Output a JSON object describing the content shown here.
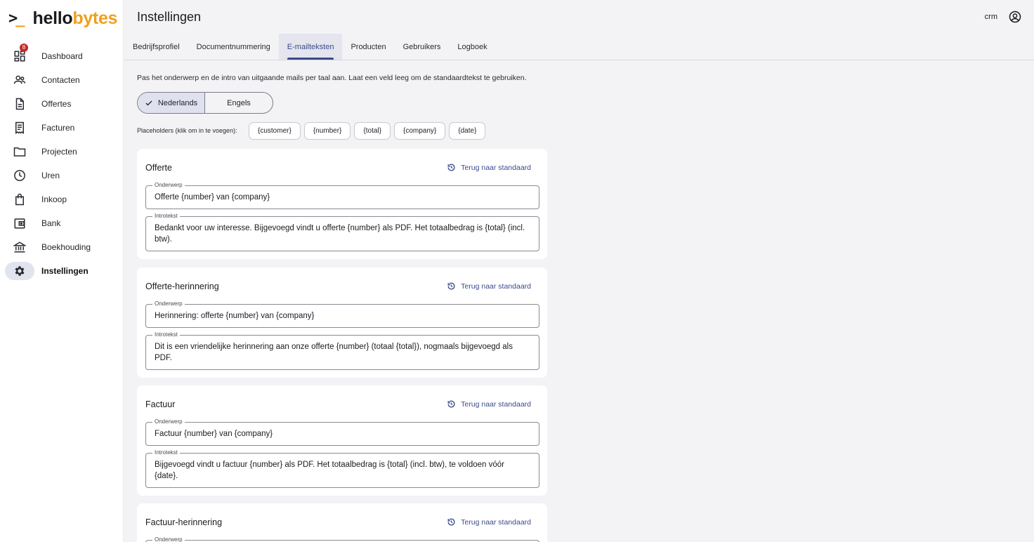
{
  "app": {
    "logo_prompt": ">",
    "logo_underscore": "_",
    "logo_hello": "hello",
    "logo_bytes": "bytes",
    "accent": "#f0a01e",
    "primary": "#3b4a8c"
  },
  "header": {
    "title": "Instellingen",
    "user": "crm"
  },
  "sidebar": {
    "items": [
      {
        "label": "Dashboard",
        "icon": "dashboard-icon",
        "badge": "8"
      },
      {
        "label": "Contacten",
        "icon": "people-icon"
      },
      {
        "label": "Offertes",
        "icon": "document-icon"
      },
      {
        "label": "Facturen",
        "icon": "receipt-icon"
      },
      {
        "label": "Projecten",
        "icon": "folder-icon"
      },
      {
        "label": "Uren",
        "icon": "clock-icon"
      },
      {
        "label": "Inkoop",
        "icon": "shopping-bag-icon"
      },
      {
        "label": "Bank",
        "icon": "wallet-icon"
      },
      {
        "label": "Boekhouding",
        "icon": "bank-icon"
      },
      {
        "label": "Instellingen",
        "icon": "gear-icon",
        "active": true
      }
    ]
  },
  "tabs": [
    {
      "label": "Bedrijfsprofiel"
    },
    {
      "label": "Documentnummering"
    },
    {
      "label": "E-mailteksten",
      "active": true
    },
    {
      "label": "Producten"
    },
    {
      "label": "Gebruikers"
    },
    {
      "label": "Logboek"
    }
  ],
  "main": {
    "description": "Pas het onderwerp en de intro van uitgaande mails per taal aan. Laat een veld leeg om de standaardtekst te gebruiken.",
    "languages": [
      {
        "label": "Nederlands",
        "selected": true
      },
      {
        "label": "Engels",
        "selected": false
      }
    ],
    "placeholders_label": "Placeholders (klik om in te voegen):",
    "placeholders": [
      "{customer}",
      "{number}",
      "{total}",
      "{company}",
      "{date}"
    ],
    "reset_label": "Terug naar standaard",
    "subject_legend": "Onderwerp",
    "intro_legend": "Introtekst",
    "cards": [
      {
        "title": "Offerte",
        "subject": "Offerte {number} van {company}",
        "intro": "Bedankt voor uw interesse. Bijgevoegd vindt u offerte {number} als PDF. Het totaalbedrag is {total} (incl. btw)."
      },
      {
        "title": "Offerte-herinnering",
        "subject": "Herinnering: offerte {number} van {company}",
        "intro": "Dit is een vriendelijke herinnering aan onze offerte {number} (totaal {total}), nogmaals bijgevoegd als PDF."
      },
      {
        "title": "Factuur",
        "subject": "Factuur {number} van {company}",
        "intro": "Bijgevoegd vindt u factuur {number} als PDF. Het totaalbedrag is {total} (incl. btw), te voldoen vóór {date}."
      },
      {
        "title": "Factuur-herinnering",
        "subject": "",
        "intro": ""
      }
    ]
  }
}
